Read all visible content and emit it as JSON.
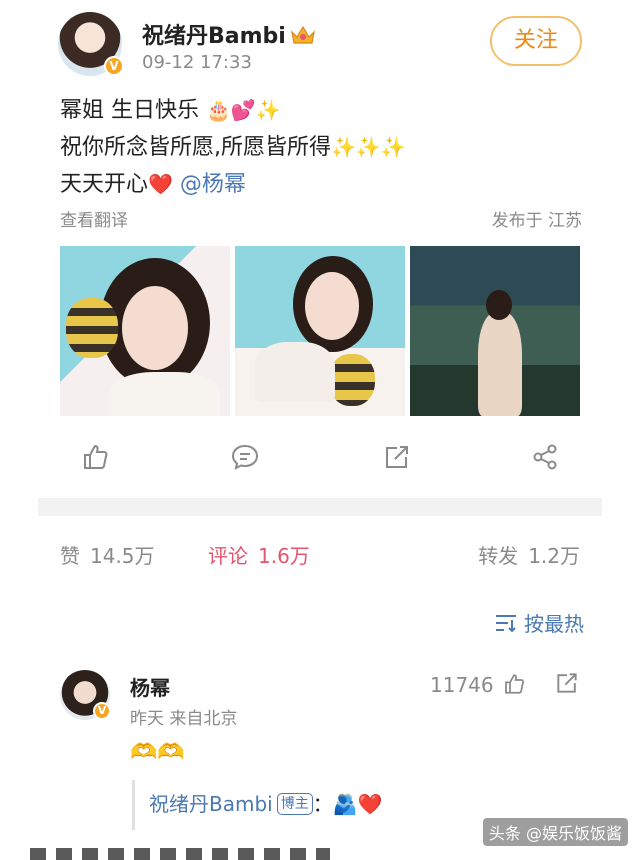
{
  "post": {
    "author": "祝绪丹Bambi",
    "time": "09-12 17:33",
    "follow_label": "关注",
    "lines": {
      "line1": "幂姐 生日快乐",
      "line1_emoji": "🎂💕✨",
      "line2": "祝你所念皆所愿,所愿皆所得",
      "line2_emoji": "✨✨✨",
      "line3": "天天开心",
      "line3_emoji": "❤️",
      "mention": "@杨幂"
    },
    "translate_label": "查看翻译",
    "location": "发布于 江苏"
  },
  "actions": [
    "like-icon",
    "comment-icon",
    "repost-icon",
    "share-icon"
  ],
  "stats": {
    "likes_label": "赞",
    "likes": "14.5万",
    "comments_label": "评论",
    "comments": "1.6万",
    "reposts_label": "转发",
    "reposts": "1.2万"
  },
  "sort": {
    "label": "按最热"
  },
  "comment": {
    "name": "杨幂",
    "likes": "11746",
    "meta": "昨天  来自北京",
    "body": "🫶🫶",
    "reply": {
      "author": "祝绪丹Bambi",
      "badge": "博主",
      "separator": "：",
      "text": "🫂❤️"
    }
  },
  "watermark": "头条 @娱乐饭饭酱",
  "colors": {
    "accent_orange": "#e98b16",
    "link_blue": "#4a79b3",
    "comment_pink": "#e5546e"
  }
}
